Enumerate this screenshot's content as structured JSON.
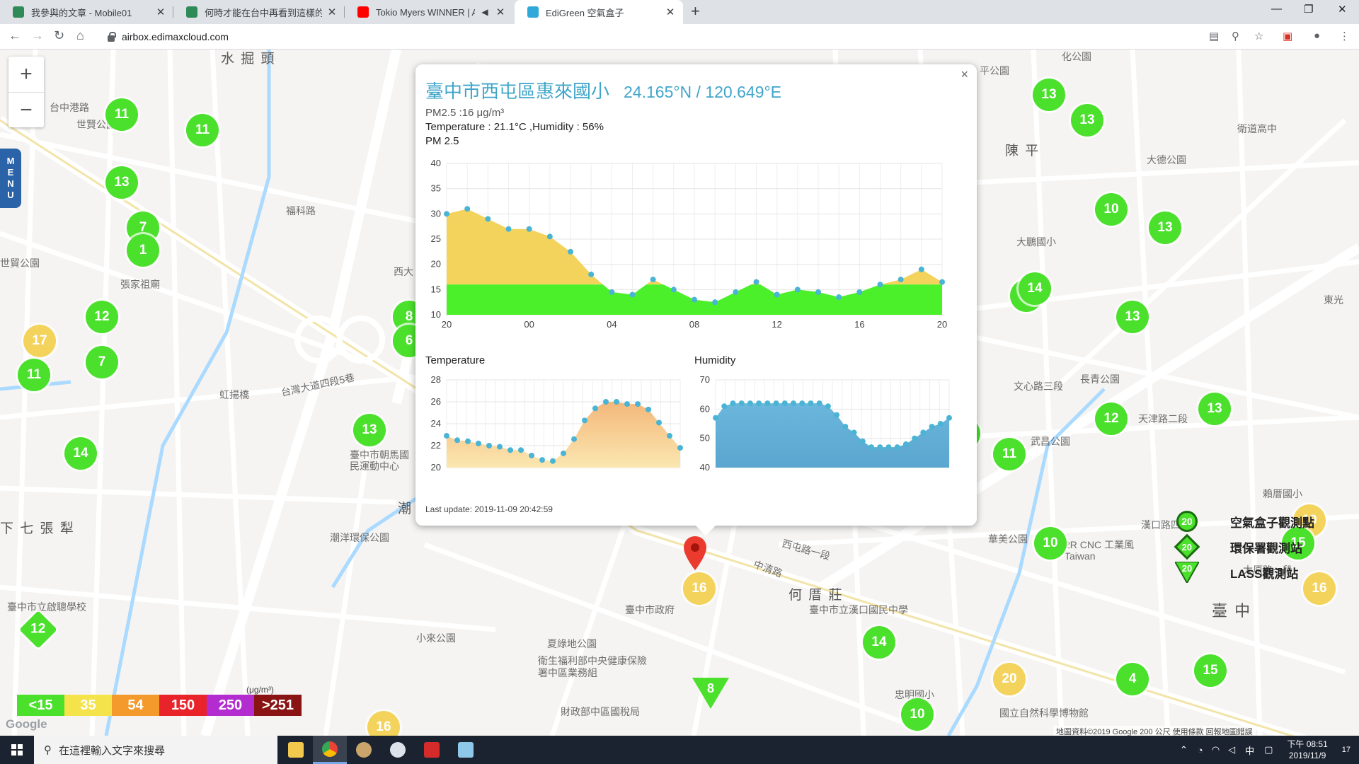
{
  "tabs": [
    {
      "title": "我參與的文章 - Mobile01",
      "favicon_color": "#2e8b57"
    },
    {
      "title": "何時才能在台中再看到這樣的藍天",
      "favicon_color": "#2e8b57"
    },
    {
      "title": "Tokio Myers WINNER | ALL",
      "favicon_color": "#ff0000"
    },
    {
      "title": "EdiGreen 空氣盒子",
      "favicon_color": "#31a9d8"
    }
  ],
  "url": "airbox.edimaxcloud.com",
  "map_labels": [
    "水 掘 頭",
    "台中港路",
    "世賢公園",
    "福科路",
    "張家祖廟",
    "世貿公園",
    "台灣大道四段5巷",
    "虹揚橋",
    "臺中市朝馬國民運動中心",
    "潮洋環保公園",
    "下 七 張 犁",
    "臺中市立啟聰學校",
    "西大",
    "潮",
    "小來公園",
    "夏綠地公園",
    "衛生福利部中央健康保險署中區業務組",
    "財政部中區國稅局",
    "臺中市政府",
    "何 厝 莊",
    "臺中市立漢口國民中學",
    "西屯路一段",
    "中清路",
    "陳 平",
    "大德公園",
    "大鵬國小",
    "衛道高中",
    "文心路三段",
    "長青公園",
    "天津路二段",
    "武昌公園",
    "華美公園",
    "2R CNC 工業風 Taiwan",
    "臺 中",
    "國立自然科學博物館",
    "忠明國小",
    "東光",
    "太原路一段",
    "漢口路四段",
    "賴厝國小",
    "平公園",
    "化公園"
  ],
  "map_markers": [
    {
      "v": "11",
      "c": "green"
    },
    {
      "v": "11",
      "c": "green"
    },
    {
      "v": "13",
      "c": "green"
    },
    {
      "v": "7",
      "c": "green"
    },
    {
      "v": "1",
      "c": "green"
    },
    {
      "v": "12",
      "c": "green"
    },
    {
      "v": "17",
      "c": "yellow"
    },
    {
      "v": "7",
      "c": "green"
    },
    {
      "v": "11",
      "c": "green"
    },
    {
      "v": "14",
      "c": "green"
    },
    {
      "v": "13",
      "c": "green"
    },
    {
      "v": "12",
      "c": "green"
    },
    {
      "v": "16",
      "c": "yellow"
    },
    {
      "v": "16",
      "c": "yellow"
    },
    {
      "v": "8",
      "c": "green"
    },
    {
      "v": "6",
      "c": "green"
    },
    {
      "v": "13",
      "c": "green"
    },
    {
      "v": "13",
      "c": "green"
    },
    {
      "v": "10",
      "c": "green"
    },
    {
      "v": "13",
      "c": "green"
    },
    {
      "v": "4",
      "c": "green"
    },
    {
      "v": "13",
      "c": "green"
    },
    {
      "v": "13",
      "c": "green"
    },
    {
      "v": "12",
      "c": "green"
    },
    {
      "v": "11",
      "c": "green"
    },
    {
      "v": "10",
      "c": "green"
    },
    {
      "v": "19",
      "c": "yellow"
    },
    {
      "v": "15",
      "c": "green"
    },
    {
      "v": "16",
      "c": "yellow"
    },
    {
      "v": "14",
      "c": "green"
    },
    {
      "v": "20",
      "c": "yellow"
    },
    {
      "v": "15",
      "c": "green"
    },
    {
      "v": "4",
      "c": "green"
    },
    {
      "v": "10",
      "c": "green"
    },
    {
      "v": "14",
      "c": "green"
    }
  ],
  "map_marker_diamond": {
    "v": "12"
  },
  "map_marker_triangle": {
    "v": "8"
  },
  "zoom_in": "+",
  "zoom_out": "−",
  "menu_label": [
    "M",
    "E",
    "N",
    "U"
  ],
  "legend": {
    "unit": "(μg/m³)",
    "cells": [
      {
        "label": "<15",
        "color": "#4be02c"
      },
      {
        "label": "35",
        "color": "#f4e34b"
      },
      {
        "label": "54",
        "color": "#f49a2c"
      },
      {
        "label": "150",
        "color": "#e8242a"
      },
      {
        "label": "250",
        "color": "#b22cd0"
      },
      {
        "label": ">251",
        "color": "#8a1414"
      }
    ]
  },
  "station_legend": [
    {
      "label": "空氣盒子觀測點",
      "badge": "20",
      "icon": "airbox-icon"
    },
    {
      "label": "環保署觀測站",
      "badge": "20",
      "icon": "epa-icon"
    },
    {
      "label": "LASS觀測站",
      "badge": "20",
      "icon": "lass-icon"
    }
  ],
  "map_attribution": "地圖資料©2019 Google   200 公尺   使用條款   回報地圖錯誤",
  "google_logo": "Google",
  "popup": {
    "title": "臺中市西屯區惠來國小",
    "coord": "24.165°N / 120.649°E",
    "pm25_line": "PM2.5 :16 μg/m³",
    "temp_line": "Temperature : 21.1°C ,Humidity : 56%",
    "pm_chart_title": "PM 2.5",
    "temp_chart_title": "Temperature",
    "hum_chart_title": "Humidity",
    "last_update": "Last update: 2019-11-09 20:42:59",
    "close": "×"
  },
  "chart_data": [
    {
      "type": "area",
      "title": "PM 2.5",
      "x_ticks": [
        "20",
        "00",
        "04",
        "08",
        "12",
        "16",
        "20"
      ],
      "y_ticks": [
        10,
        15,
        20,
        25,
        30,
        35,
        40
      ],
      "ylim": [
        10,
        40
      ],
      "threshold": 16,
      "threshold_colors": {
        "below": "#4cf02a",
        "above": "#f4d35c"
      },
      "values": [
        30,
        31,
        29,
        27,
        27,
        25.5,
        22.5,
        18,
        14.5,
        14,
        17,
        15,
        13,
        12.5,
        14.5,
        16.5,
        14,
        15,
        14.5,
        13.5,
        14.5,
        16,
        17,
        19,
        16.5
      ]
    },
    {
      "type": "area",
      "title": "Temperature",
      "y_ticks": [
        20,
        22,
        24,
        26,
        28
      ],
      "ylim": [
        20,
        28
      ],
      "values": [
        22.9,
        22.5,
        22.4,
        22.2,
        22.0,
        21.9,
        21.6,
        21.6,
        21.1,
        20.7,
        20.6,
        21.3,
        22.6,
        24.3,
        25.4,
        26.0,
        26.0,
        25.8,
        25.8,
        25.3,
        24.1,
        22.9,
        21.8
      ]
    },
    {
      "type": "area",
      "title": "Humidity",
      "y_ticks": [
        40,
        50,
        60,
        70
      ],
      "ylim": [
        40,
        70
      ],
      "values": [
        57,
        61,
        62,
        62,
        62,
        62,
        62,
        62,
        62,
        62,
        62,
        62,
        62,
        61,
        58,
        54,
        52,
        49,
        47,
        47,
        47,
        47,
        48,
        50,
        52,
        54,
        55,
        57
      ]
    }
  ],
  "taskbar": {
    "search_placeholder": "在這裡輸入文字來搜尋",
    "time": "下午 08:51",
    "date": "2019/11/9",
    "ime": "中",
    "notif_count": "17"
  }
}
